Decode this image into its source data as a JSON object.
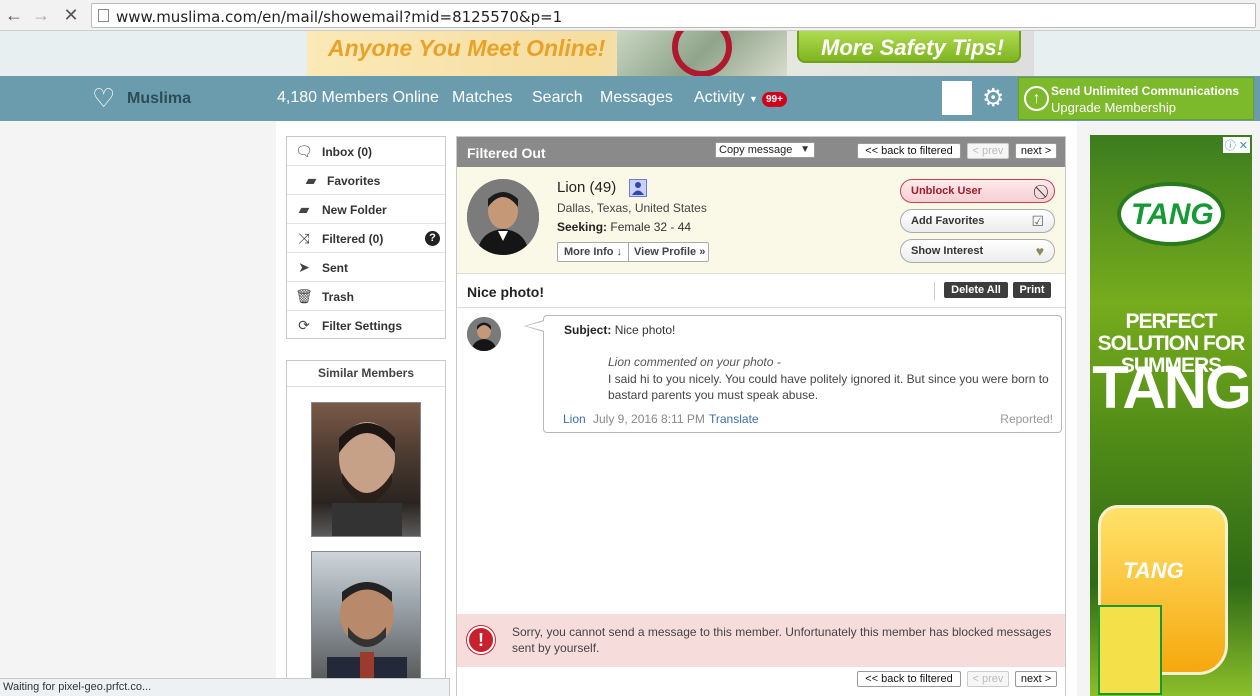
{
  "browser": {
    "url": "www.muslima.com/en/mail/showemail?mid=8125570&p=1",
    "status": "Waiting for pixel-geo.prfct.co..."
  },
  "top_ad": {
    "headline": "Anyone You Meet Online!",
    "button": "More Safety Tips!"
  },
  "nav": {
    "brand": "Muslima",
    "members_online": "4,180 Members Online",
    "matches": "Matches",
    "search": "Search",
    "messages": "Messages",
    "activity": "Activity",
    "activity_badge": "99+",
    "upgrade_line1": "Send Unlimited Communications",
    "upgrade_line2": "Upgrade Membership"
  },
  "folders": [
    {
      "label": "Inbox (0)",
      "icon": "speech-bubble-icon"
    },
    {
      "label": "Favorites",
      "icon": "folder-check-icon"
    },
    {
      "label": "New Folder",
      "icon": "folder-plus-icon"
    },
    {
      "label": "Filtered (0)",
      "icon": "shuffle-icon"
    },
    {
      "label": "Sent",
      "icon": "paper-plane-icon"
    },
    {
      "label": "Trash",
      "icon": "trash-icon"
    },
    {
      "label": "Filter Settings",
      "icon": "refresh-icon"
    }
  ],
  "similar": {
    "heading": "Similar Members"
  },
  "panel": {
    "title": "Filtered Out",
    "copy_select": "Copy message",
    "back": "<< back to filtered",
    "prev": "< prev",
    "next": "next >"
  },
  "profile": {
    "name": "Lion (49)",
    "location": "Dallas, Texas, United States",
    "seeking_label": "Seeking:",
    "seeking_value": "Female 32 - 44",
    "more_info": "More Info ↓",
    "view_profile": "View Profile »",
    "unblock": "Unblock User",
    "add_favorites": "Add Favorites",
    "show_interest": "Show Interest"
  },
  "message": {
    "subject_title": "Nice photo!",
    "delete_all": "Delete All",
    "print": "Print",
    "subject_label": "Subject:",
    "subject": "Nice photo!",
    "note": "Lion commented on your photo -",
    "body": "I said hi to you nicely. You could have politely ignored it. But since you were born to bastard parents you must speak abuse.",
    "from": "Lion",
    "date": "July 9, 2016 8:11 PM",
    "translate": "Translate",
    "reported": "Reported!"
  },
  "blocked_notice": "Sorry, you cannot send a message to this member. Unfortunately this member has blocked messages sent by yourself.",
  "side_ad": {
    "brand": "TANG",
    "tagline": "PERFECT SOLUTION FOR SUMMERS",
    "big": "TANG",
    "jug_label": "TANG"
  }
}
